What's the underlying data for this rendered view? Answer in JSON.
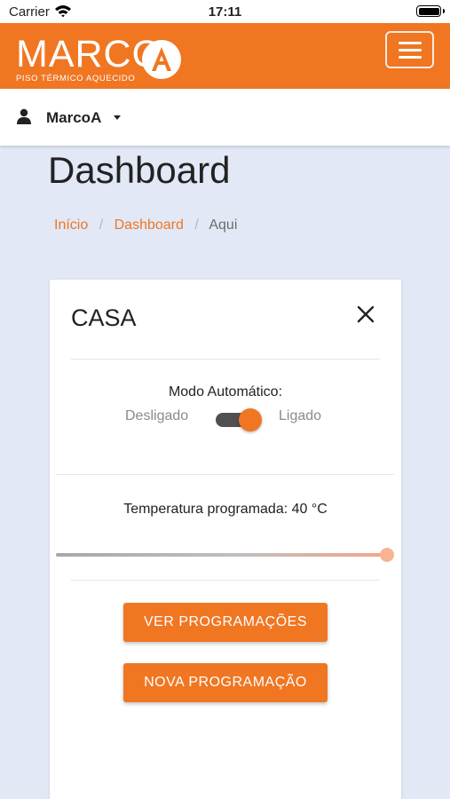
{
  "status_bar": {
    "carrier": "Carrier",
    "time": "17:11"
  },
  "navbar": {
    "logo_text": "MARCO",
    "logo_tagline": "PISO TÉRMICO AQUECIDO",
    "logo_badge_letter": "A",
    "brand_color": "#f07622"
  },
  "user_menu": {
    "name": "MarcoA"
  },
  "page": {
    "title": "Dashboard",
    "breadcrumb": [
      "Início",
      "Dashboard",
      "Aqui"
    ]
  },
  "card": {
    "title": "CASA",
    "mode_label": "Modo Automático:",
    "toggle_off_label": "Desligado",
    "toggle_on_label": "Ligado",
    "auto_mode_on": true,
    "temperature_label": "Temperatura programada: 40 °C",
    "temperature_value": 40,
    "temperature_slider_fraction": 1.0,
    "buttons": {
      "view_schedules": "VER PROGRAMAÇÕES",
      "new_schedule": "NOVA PROGRAMAÇÃO"
    }
  },
  "colors": {
    "accent": "#f07622",
    "background": "#e2e8f5",
    "card": "#ffffff"
  }
}
